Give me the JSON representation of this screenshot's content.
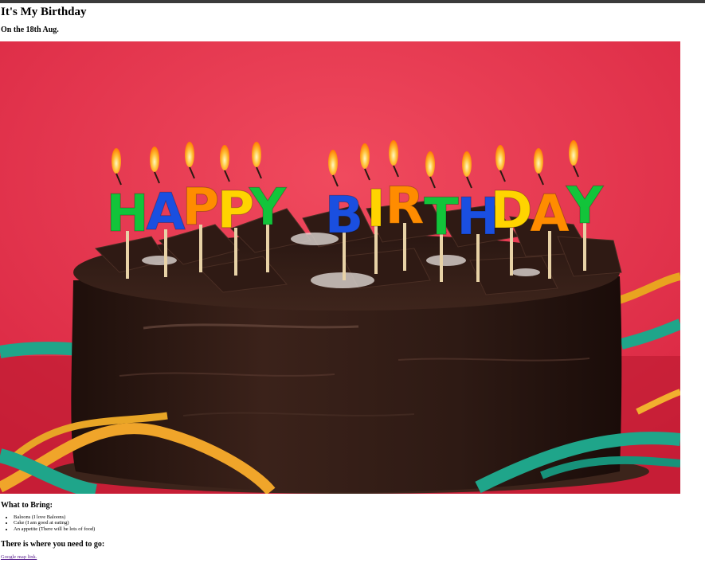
{
  "page": {
    "title": "It's My Birthday",
    "subtitle": "On the 18th Aug."
  },
  "photo": {
    "alt": "Happy Birthday chocolate cake",
    "candle_text": "HAPPY BIRTHDAY",
    "candle_colors": [
      "#12c43a",
      "#1a4fe0",
      "#ff8c00",
      "#ffd400",
      "#12c43a",
      "#1a4fe0",
      "#ffd400",
      "#ff8c00",
      "#12c43a",
      "#1a4fe0",
      "#ffd400",
      "#ff8c00",
      "#12c43a"
    ],
    "background_color": "#e42d47",
    "cake_color": "#2b1712"
  },
  "bring": {
    "heading": "What to Bring:",
    "items": [
      "Baloons (I love Baloons)",
      "Cake (I am good at eating)",
      "An appetite (There will be lots of food)"
    ]
  },
  "where": {
    "heading": "There is where you need to go:",
    "link_label": "Google map link."
  }
}
